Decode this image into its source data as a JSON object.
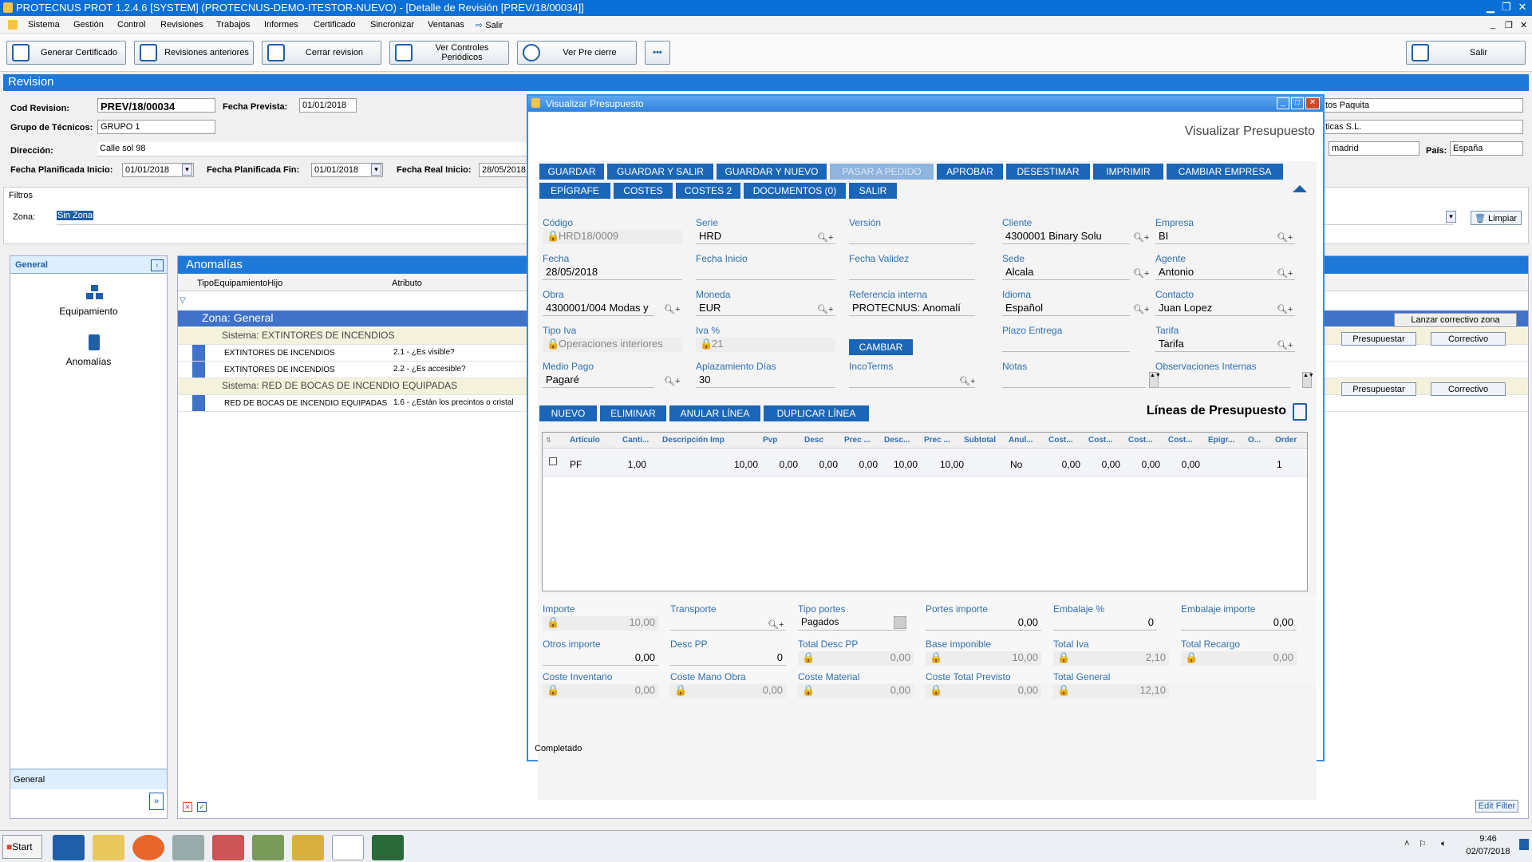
{
  "window": {
    "title": "PROTECNUS PROT 1.2.4.6 [SYSTEM] (PROTECNUS-DEMO-ITESTOR-NUEVO) - [Detalle de Revisión [PREV/18/00034]]"
  },
  "menu": [
    "Sistema",
    "Gestión",
    "Control",
    "Revisiones",
    "Trabajos",
    "Informes",
    "Certificado",
    "Sincronizar",
    "Ventanas",
    "Salir"
  ],
  "toolbar": {
    "generar": "Generar Certificado",
    "anteriores": "Revisiones anteriores",
    "cerrar": "Cerrar revision",
    "controles": "Ver Controles Periódicos",
    "precierre": "Ver Pre cierre",
    "salir": "Salir"
  },
  "revision": {
    "header": "Revision",
    "cod_label": "Cod Revision:",
    "cod": "PREV/18/00034",
    "fprev_label": "Fecha Prevista:",
    "fprev": "01/01/2018",
    "grupo_label": "Grupo de Técnicos:",
    "grupo": "GRUPO 1",
    "dir_label": "Dirección:",
    "dir": "Calle sol 98",
    "fpi_label": "Fecha Planificada Inicio:",
    "fpi": "01/01/2018",
    "fpf_label": "Fecha Planificada Fin:",
    "fpf": "01/01/2018",
    "fri_label": "Fecha Real Inicio:",
    "fri": "28/05/2018",
    "r1": "tos Paquita",
    "r2": "ticas S.L.",
    "r3": "madrid",
    "pais_label": "País:",
    "pais": "España"
  },
  "filtros": {
    "title": "Filtros",
    "zona_label": "Zona:",
    "zona": "Sin Zona",
    "limpiar": "Limpiar"
  },
  "left": {
    "title": "General",
    "items": [
      "Equipamiento",
      "Anomalías"
    ],
    "footer": "General"
  },
  "anomalias": {
    "title": "Anomalías",
    "col1": "TipoEquipamientoHijo",
    "col2": "Atributo",
    "zona": "Zona: General",
    "sys1": "Sistema: EXTINTORES DE INCENDIOS",
    "r1a": "EXTINTORES DE INCENDIOS",
    "r1b": "2.1 - ¿Es visible?",
    "r2a": "EXTINTORES DE INCENDIOS",
    "r2b": "2.2 - ¿Es accesible?",
    "sys2": "Sistema: RED DE BOCAS DE INCENDIO EQUIPADAS",
    "r3a": "RED DE BOCAS DE INCENDIO EQUIPADAS",
    "r3b": "1.6 - ¿Están los precintos o cristal",
    "lanzar": "Lanzar correctivo zona",
    "presupuestar": "Presupuestar",
    "correctivo": "Correctivo",
    "edit_filter": "Edit Filter"
  },
  "dialog": {
    "title": "Visualizar Presupuesto",
    "subtitle": "Visualizar Presupuesto",
    "btns1": [
      "GUARDAR",
      "GUARDAR Y SALIR",
      "GUARDAR Y NUEVO",
      "PASAR A PEDIDO",
      "APROBAR",
      "DESESTIMAR",
      "IMPRIMIR",
      "CAMBIAR EMPRESA"
    ],
    "btns2": [
      "EPÍGRAFE",
      "COSTES",
      "COSTES 2",
      "DOCUMENTOS (0)",
      "SALIR"
    ],
    "f": {
      "codigo_l": "Código",
      "codigo": "HRD18/0009",
      "serie_l": "Serie",
      "serie": "HRD",
      "version_l": "Versión",
      "version": "",
      "cliente_l": "Cliente",
      "cliente": "4300001 Binary Solu",
      "empresa_l": "Empresa",
      "empresa": "BI",
      "fecha_l": "Fecha",
      "fecha": "28/05/2018",
      "finicio_l": "Fecha Inicio",
      "fvalidez_l": "Fecha Validez",
      "sede_l": "Sede",
      "sede": "Alcala",
      "agente_l": "Agente",
      "agente": "Antonio",
      "obra_l": "Obra",
      "obra": "4300001/004 Modas y",
      "moneda_l": "Moneda",
      "moneda": "EUR",
      "refint_l": "Referencia interna",
      "refint": "PROTECNUS: Anomalí",
      "idioma_l": "Idioma",
      "idioma": "Español",
      "contacto_l": "Contacto",
      "contacto": "Juan Lopez",
      "tipoiva_l": "Tipo Iva",
      "tipoiva": "Operaciones interiores",
      "iva_l": "Iva %",
      "iva": "21",
      "cambiar": "CAMBIAR",
      "plazo_l": "Plazo Entrega",
      "tarifa_l": "Tarifa",
      "tarifa": "Tarifa",
      "mpago_l": "Medio Pago",
      "mpago": "Pagaré",
      "aplaz_l": "Aplazamiento Días",
      "aplaz": "30",
      "inco_l": "IncoTerms",
      "notas_l": "Notas",
      "obs_l": "Observaciones Internas"
    },
    "lbtns": [
      "NUEVO",
      "ELIMINAR",
      "ANULAR LÍNEA",
      "DUPLICAR LÍNEA"
    ],
    "lines_title": "Líneas de Presupuesto",
    "cols": [
      "Artículo",
      "Canti...",
      "Descripción Imp",
      "Pvp",
      "Desc",
      "Prec ...",
      "Desc...",
      "Prec ...",
      "Subtotal",
      "Anul...",
      "Cost...",
      "Cost...",
      "Cost...",
      "Cost...",
      "Epigr...",
      "O...",
      "Order"
    ],
    "row": [
      "PF",
      "1,00",
      "",
      "10,00",
      "0,00",
      "0,00",
      "0,00",
      "10,00",
      "10,00",
      "No",
      "0,00",
      "0,00",
      "0,00",
      "0,00",
      "",
      "",
      "1"
    ],
    "t": {
      "importe_l": "Importe",
      "importe": "10,00",
      "transp_l": "Transporte",
      "tportes_l": "Tipo portes",
      "tportes": "Pagados",
      "portesimp_l": "Portes importe",
      "portesimp": "0,00",
      "embp_l": "Embalaje %",
      "embp": "0",
      "embi_l": "Embalaje importe",
      "embi": "0,00",
      "otros_l": "Otros importe",
      "otros": "0,00",
      "descpp_l": "Desc PP",
      "descpp": "0",
      "tdpp_l": "Total Desc PP",
      "tdpp": "0,00",
      "base_l": "Base imponible",
      "base": "10,00",
      "tiva_l": "Total Iva",
      "tiva": "2,10",
      "trec_l": "Total Recargo",
      "trec": "0,00",
      "cinv_l": "Coste Inventario",
      "cinv": "0,00",
      "cmo_l": "Coste Mano Obra",
      "cmo": "0,00",
      "cmat_l": "Coste Material",
      "cmat": "0,00",
      "ctp_l": "Coste Total Previsto",
      "ctp": "0,00",
      "tgen_l": "Total General",
      "tgen": "12,10"
    },
    "status": "Completado"
  },
  "taskbar": {
    "start": "Start",
    "time": "9:46",
    "date": "02/07/2018"
  }
}
